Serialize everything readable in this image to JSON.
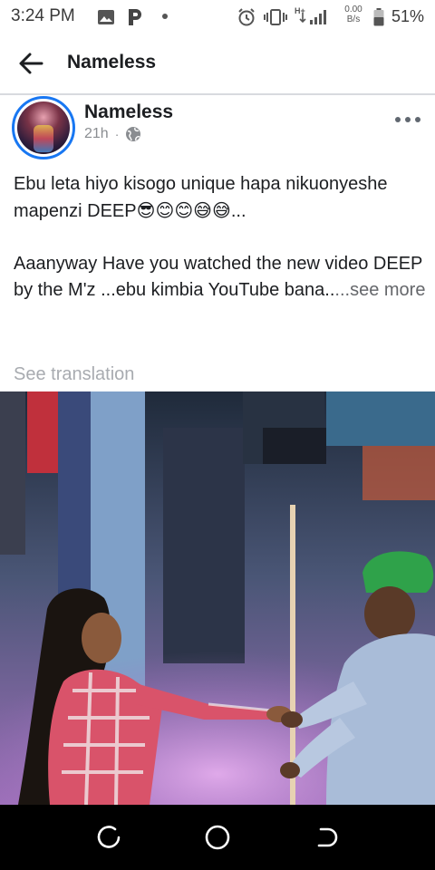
{
  "status_bar": {
    "time": "3:24 PM",
    "net_speed_value": "0.00",
    "net_speed_unit": "B/s",
    "network_type": "H+",
    "battery_percent": "51%",
    "icons": [
      "image-notification-icon",
      "p-app-notification-icon",
      "more-notifications-dot-icon",
      "alarm-icon",
      "vibrate-icon",
      "signal-icon",
      "battery-icon"
    ]
  },
  "app_bar": {
    "title": "Nameless",
    "back_icon": "arrow-left-icon"
  },
  "post": {
    "author": "Nameless",
    "time_ago": "21h",
    "separator": "·",
    "privacy_icon": "globe-icon",
    "more_icon": "more-horizontal-icon",
    "text_line_1": "Ebu leta hiyo kisogo unique hapa nikuonyeshe mapenzi DEEP",
    "emojis": "😎😊😊😅😅",
    "text_line_1_end": "...",
    "text_line_2": "Aaanyway Have you watched the new video DEEP by the M'z ...ebu kimbia YouTube bana..",
    "see_more": "...see more",
    "see_translation": "See translation"
  },
  "nav_bar": {
    "icons": [
      "recent-apps-icon",
      "home-icon",
      "back-nav-icon"
    ]
  },
  "colors": {
    "accent": "#1877f2",
    "text": "#1c1e21",
    "secondary_text": "#8a8d91",
    "translation_text": "#a8abb0"
  }
}
